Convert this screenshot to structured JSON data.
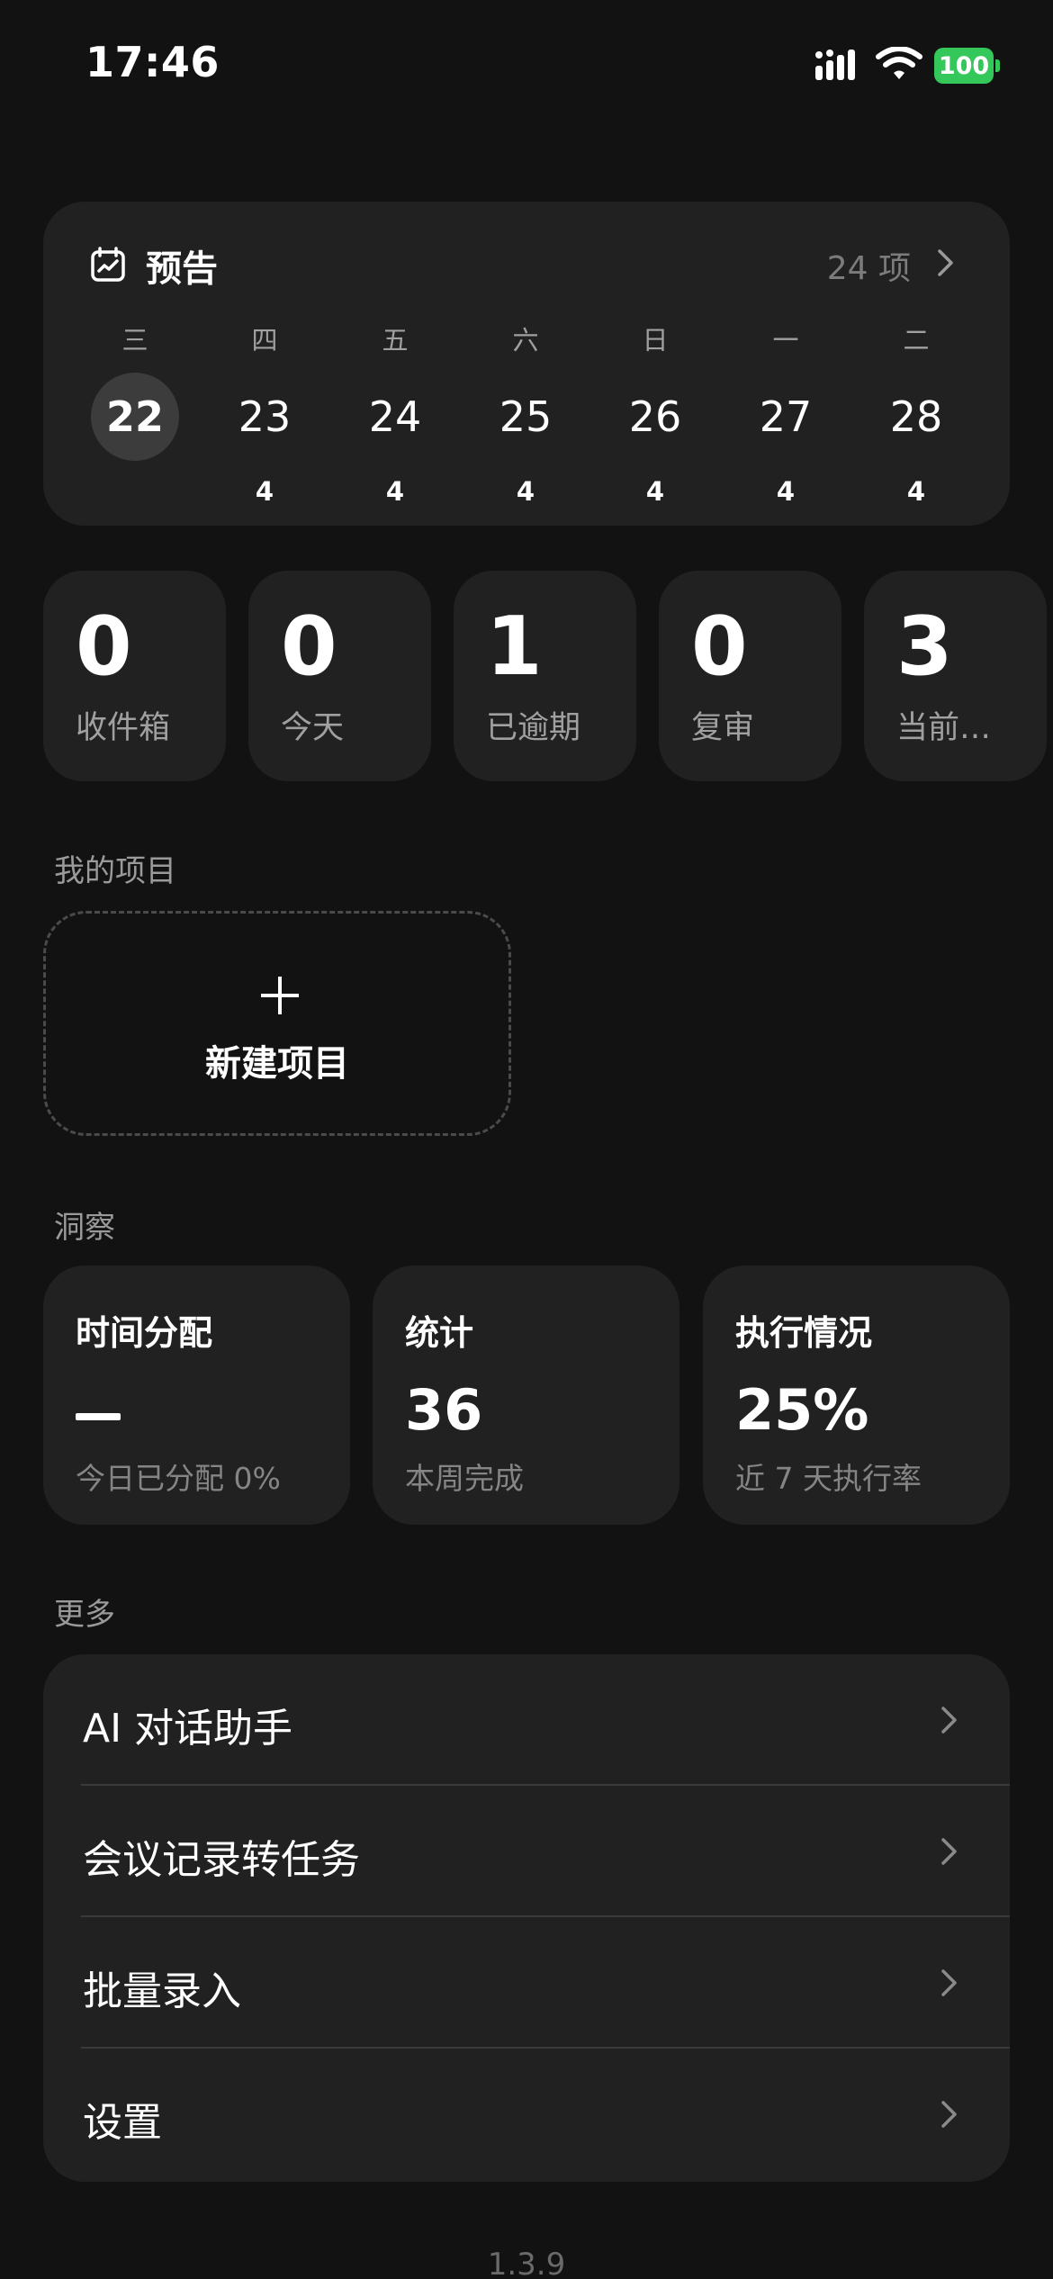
{
  "status_bar": {
    "time": "17:46",
    "battery": "100",
    "battery_color": "#34c759"
  },
  "forecast": {
    "title": "预告",
    "count": "24 项",
    "icon": "calendar-icon",
    "days": [
      {
        "weekday": "三",
        "date": "22",
        "count": "",
        "today": true
      },
      {
        "weekday": "四",
        "date": "23",
        "count": "4"
      },
      {
        "weekday": "五",
        "date": "24",
        "count": "4"
      },
      {
        "weekday": "六",
        "date": "25",
        "count": "4"
      },
      {
        "weekday": "日",
        "date": "26",
        "count": "4"
      },
      {
        "weekday": "一",
        "date": "27",
        "count": "4"
      },
      {
        "weekday": "二",
        "date": "28",
        "count": "4"
      }
    ]
  },
  "stats": [
    {
      "value": "0",
      "label": "收件箱"
    },
    {
      "value": "0",
      "label": "今天"
    },
    {
      "value": "1",
      "label": "已逾期"
    },
    {
      "value": "0",
      "label": "复审"
    },
    {
      "value": "3",
      "label": "当前…"
    }
  ],
  "projects": {
    "section_label": "我的项目",
    "new_label": "新建项目"
  },
  "insights": {
    "section_label": "洞察",
    "cards": [
      {
        "title": "时间分配",
        "value": "—",
        "subtitle": "今日已分配 0%"
      },
      {
        "title": "统计",
        "value": "36",
        "subtitle": "本周完成"
      },
      {
        "title": "执行情况",
        "value": "25%",
        "subtitle": "近 7 天执行率"
      }
    ]
  },
  "more": {
    "section_label": "更多",
    "items": [
      {
        "label": "AI 对话助手"
      },
      {
        "label": "会议记录转任务"
      },
      {
        "label": "批量录入"
      },
      {
        "label": "设置"
      }
    ]
  },
  "version": "1.3.9"
}
